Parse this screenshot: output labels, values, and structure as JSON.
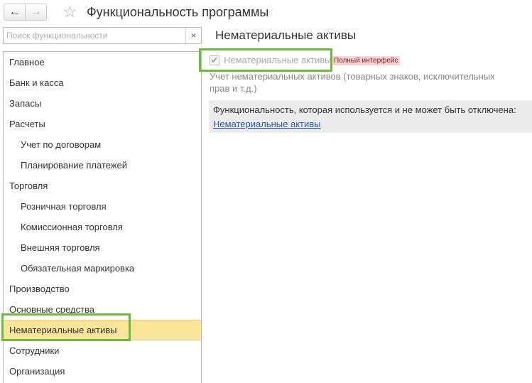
{
  "window": {
    "title": "Функциональность программы"
  },
  "toolbar": {
    "back_glyph": "←",
    "forward_glyph": "→",
    "favorite_glyph": "☆"
  },
  "search": {
    "placeholder": "Поиск функциональности",
    "value": "",
    "clear_glyph": "×"
  },
  "sidebar": {
    "items": [
      {
        "label": "Главное",
        "level": 0
      },
      {
        "label": "Банк и касса",
        "level": 0
      },
      {
        "label": "Запасы",
        "level": 0
      },
      {
        "label": "Расчеты",
        "level": 0
      },
      {
        "label": "Учет по договорам",
        "level": 1
      },
      {
        "label": "Планирование платежей",
        "level": 1
      },
      {
        "label": "Торговля",
        "level": 0
      },
      {
        "label": "Розничная торговля",
        "level": 1
      },
      {
        "label": "Комиссионная торговля",
        "level": 1
      },
      {
        "label": "Внешняя торговля",
        "level": 1
      },
      {
        "label": "Обязательная маркировка",
        "level": 1
      },
      {
        "label": "Производство",
        "level": 0
      },
      {
        "label": "Основные средства",
        "level": 0
      },
      {
        "label": "Нематериальные активы",
        "level": 0,
        "selected": true
      },
      {
        "label": "Сотрудники",
        "level": 0
      },
      {
        "label": "Организация",
        "level": 0
      }
    ]
  },
  "main": {
    "section_title": "Нематериальные активы",
    "option": {
      "label": "Нематериальные активы",
      "checked": true,
      "check_glyph": "✔",
      "badge": "Полный интерфейс",
      "description": "Учет нематериальных активов (товарных знаков, исключительных прав и т.д.)"
    },
    "info": {
      "text": "Функциональность, которая используется и не может быть отключена:",
      "link": "Нематериальные активы"
    }
  },
  "colors": {
    "highlight": "#6cbd3d",
    "selected_bg": "#fbe59a",
    "badge_bg": "#f5d3d3",
    "link": "#2a5ab5"
  }
}
